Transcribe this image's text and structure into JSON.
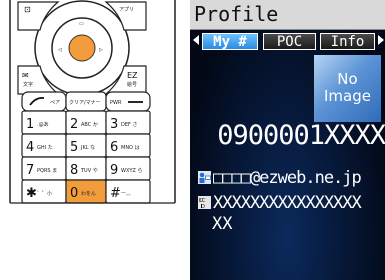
{
  "keypad": {
    "nav": {
      "book_label": "⊡",
      "appli_label": "アプリ",
      "mail_label": "✉",
      "mail_sub": "文字",
      "ez_label": "EZ",
      "ez_sub": "絵号",
      "center_left": "▷",
      "center_right": "◁",
      "center_top": "▷"
    },
    "row0": [
      {
        "sym": "↗",
        "sub": "ペア"
      },
      {
        "sym": "クリア/マナー",
        "sub": ""
      },
      {
        "sym": "PWR",
        "sub": "↘"
      }
    ],
    "keys": [
      {
        "num": "1",
        "sub": ".@あ"
      },
      {
        "num": "2",
        "sub": "ABC か"
      },
      {
        "num": "3",
        "sub": "DEF さ"
      },
      {
        "num": "4",
        "sub": "GHI た"
      },
      {
        "num": "5",
        "sub": "JKL な"
      },
      {
        "num": "6",
        "sub": "MNO は"
      },
      {
        "num": "7",
        "sub": "PQRS ま"
      },
      {
        "num": "8",
        "sub": "TUV や"
      },
      {
        "num": "9",
        "sub": "WXYZ ら"
      },
      {
        "num": "✱",
        "sub": "゛゜小"
      },
      {
        "num": "0",
        "sub": "わをん"
      },
      {
        "num": "#",
        "sub": "ー、。"
      }
    ],
    "accent_color": "#f39c3c"
  },
  "screen": {
    "title": "Profile",
    "tabs": [
      {
        "label": "My #",
        "active": true
      },
      {
        "label": "POC",
        "active": false
      },
      {
        "label": "Info",
        "active": false
      }
    ],
    "no_image": {
      "line1": "No",
      "line2": "Image"
    },
    "phone_number": "0900001XXXX",
    "email": "□□□□@ezweb.ne.jp",
    "id_line1": "XXXXXXXXXXXXXXXX",
    "id_line2": "XX",
    "tab_active_color": "#3aa3f5",
    "background_color": "#061634"
  }
}
